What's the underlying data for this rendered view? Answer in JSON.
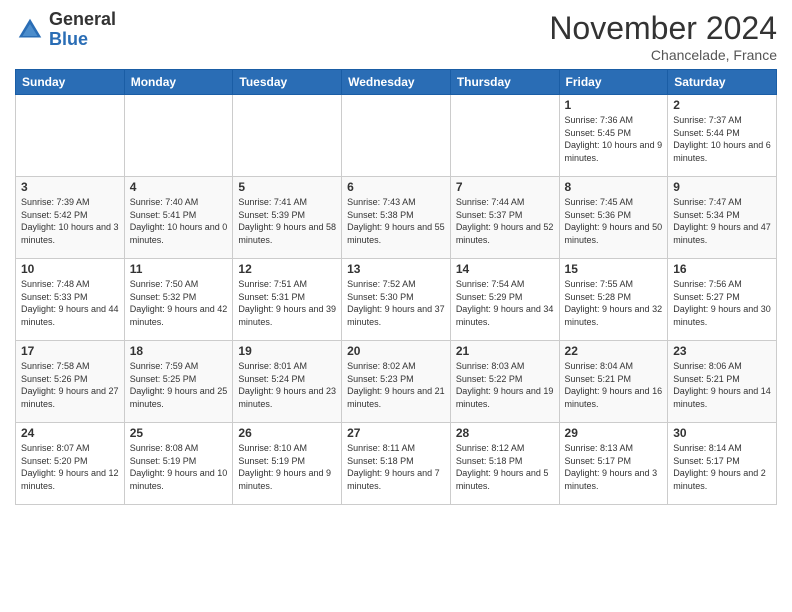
{
  "logo": {
    "general": "General",
    "blue": "Blue"
  },
  "title": "November 2024",
  "location": "Chancelade, France",
  "days_of_week": [
    "Sunday",
    "Monday",
    "Tuesday",
    "Wednesday",
    "Thursday",
    "Friday",
    "Saturday"
  ],
  "weeks": [
    [
      null,
      null,
      null,
      null,
      null,
      {
        "day": "1",
        "sunrise": "Sunrise: 7:36 AM",
        "sunset": "Sunset: 5:45 PM",
        "daylight": "Daylight: 10 hours and 9 minutes."
      },
      {
        "day": "2",
        "sunrise": "Sunrise: 7:37 AM",
        "sunset": "Sunset: 5:44 PM",
        "daylight": "Daylight: 10 hours and 6 minutes."
      }
    ],
    [
      {
        "day": "3",
        "sunrise": "Sunrise: 7:39 AM",
        "sunset": "Sunset: 5:42 PM",
        "daylight": "Daylight: 10 hours and 3 minutes."
      },
      {
        "day": "4",
        "sunrise": "Sunrise: 7:40 AM",
        "sunset": "Sunset: 5:41 PM",
        "daylight": "Daylight: 10 hours and 0 minutes."
      },
      {
        "day": "5",
        "sunrise": "Sunrise: 7:41 AM",
        "sunset": "Sunset: 5:39 PM",
        "daylight": "Daylight: 9 hours and 58 minutes."
      },
      {
        "day": "6",
        "sunrise": "Sunrise: 7:43 AM",
        "sunset": "Sunset: 5:38 PM",
        "daylight": "Daylight: 9 hours and 55 minutes."
      },
      {
        "day": "7",
        "sunrise": "Sunrise: 7:44 AM",
        "sunset": "Sunset: 5:37 PM",
        "daylight": "Daylight: 9 hours and 52 minutes."
      },
      {
        "day": "8",
        "sunrise": "Sunrise: 7:45 AM",
        "sunset": "Sunset: 5:36 PM",
        "daylight": "Daylight: 9 hours and 50 minutes."
      },
      {
        "day": "9",
        "sunrise": "Sunrise: 7:47 AM",
        "sunset": "Sunset: 5:34 PM",
        "daylight": "Daylight: 9 hours and 47 minutes."
      }
    ],
    [
      {
        "day": "10",
        "sunrise": "Sunrise: 7:48 AM",
        "sunset": "Sunset: 5:33 PM",
        "daylight": "Daylight: 9 hours and 44 minutes."
      },
      {
        "day": "11",
        "sunrise": "Sunrise: 7:50 AM",
        "sunset": "Sunset: 5:32 PM",
        "daylight": "Daylight: 9 hours and 42 minutes."
      },
      {
        "day": "12",
        "sunrise": "Sunrise: 7:51 AM",
        "sunset": "Sunset: 5:31 PM",
        "daylight": "Daylight: 9 hours and 39 minutes."
      },
      {
        "day": "13",
        "sunrise": "Sunrise: 7:52 AM",
        "sunset": "Sunset: 5:30 PM",
        "daylight": "Daylight: 9 hours and 37 minutes."
      },
      {
        "day": "14",
        "sunrise": "Sunrise: 7:54 AM",
        "sunset": "Sunset: 5:29 PM",
        "daylight": "Daylight: 9 hours and 34 minutes."
      },
      {
        "day": "15",
        "sunrise": "Sunrise: 7:55 AM",
        "sunset": "Sunset: 5:28 PM",
        "daylight": "Daylight: 9 hours and 32 minutes."
      },
      {
        "day": "16",
        "sunrise": "Sunrise: 7:56 AM",
        "sunset": "Sunset: 5:27 PM",
        "daylight": "Daylight: 9 hours and 30 minutes."
      }
    ],
    [
      {
        "day": "17",
        "sunrise": "Sunrise: 7:58 AM",
        "sunset": "Sunset: 5:26 PM",
        "daylight": "Daylight: 9 hours and 27 minutes."
      },
      {
        "day": "18",
        "sunrise": "Sunrise: 7:59 AM",
        "sunset": "Sunset: 5:25 PM",
        "daylight": "Daylight: 9 hours and 25 minutes."
      },
      {
        "day": "19",
        "sunrise": "Sunrise: 8:01 AM",
        "sunset": "Sunset: 5:24 PM",
        "daylight": "Daylight: 9 hours and 23 minutes."
      },
      {
        "day": "20",
        "sunrise": "Sunrise: 8:02 AM",
        "sunset": "Sunset: 5:23 PM",
        "daylight": "Daylight: 9 hours and 21 minutes."
      },
      {
        "day": "21",
        "sunrise": "Sunrise: 8:03 AM",
        "sunset": "Sunset: 5:22 PM",
        "daylight": "Daylight: 9 hours and 19 minutes."
      },
      {
        "day": "22",
        "sunrise": "Sunrise: 8:04 AM",
        "sunset": "Sunset: 5:21 PM",
        "daylight": "Daylight: 9 hours and 16 minutes."
      },
      {
        "day": "23",
        "sunrise": "Sunrise: 8:06 AM",
        "sunset": "Sunset: 5:21 PM",
        "daylight": "Daylight: 9 hours and 14 minutes."
      }
    ],
    [
      {
        "day": "24",
        "sunrise": "Sunrise: 8:07 AM",
        "sunset": "Sunset: 5:20 PM",
        "daylight": "Daylight: 9 hours and 12 minutes."
      },
      {
        "day": "25",
        "sunrise": "Sunrise: 8:08 AM",
        "sunset": "Sunset: 5:19 PM",
        "daylight": "Daylight: 9 hours and 10 minutes."
      },
      {
        "day": "26",
        "sunrise": "Sunrise: 8:10 AM",
        "sunset": "Sunset: 5:19 PM",
        "daylight": "Daylight: 9 hours and 9 minutes."
      },
      {
        "day": "27",
        "sunrise": "Sunrise: 8:11 AM",
        "sunset": "Sunset: 5:18 PM",
        "daylight": "Daylight: 9 hours and 7 minutes."
      },
      {
        "day": "28",
        "sunrise": "Sunrise: 8:12 AM",
        "sunset": "Sunset: 5:18 PM",
        "daylight": "Daylight: 9 hours and 5 minutes."
      },
      {
        "day": "29",
        "sunrise": "Sunrise: 8:13 AM",
        "sunset": "Sunset: 5:17 PM",
        "daylight": "Daylight: 9 hours and 3 minutes."
      },
      {
        "day": "30",
        "sunrise": "Sunrise: 8:14 AM",
        "sunset": "Sunset: 5:17 PM",
        "daylight": "Daylight: 9 hours and 2 minutes."
      }
    ]
  ]
}
